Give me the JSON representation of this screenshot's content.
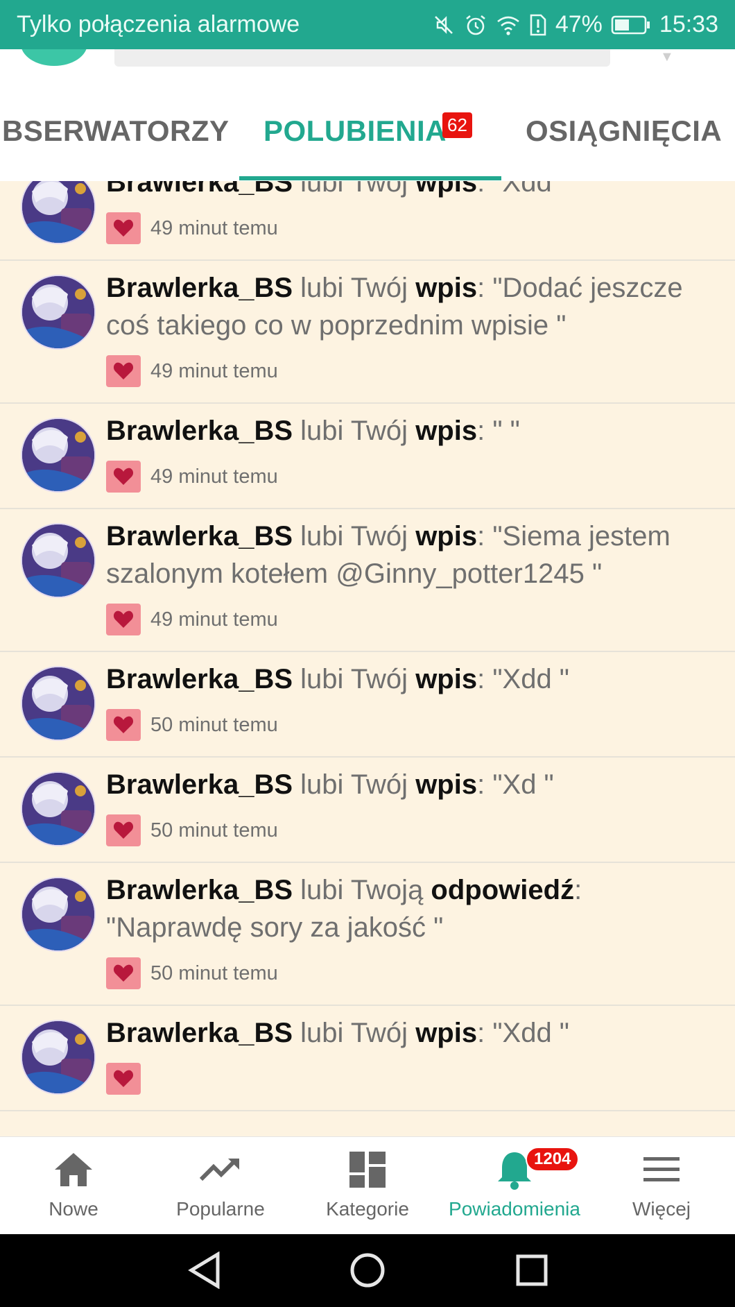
{
  "status_bar": {
    "carrier_text": "Tylko połączenia alarmowe",
    "battery_percent": "47%",
    "time": "15:33",
    "icons": [
      "mute-icon",
      "alarm-icon",
      "wifi-icon",
      "sim-alert-icon",
      "battery-icon"
    ]
  },
  "tabs": {
    "items": [
      {
        "label": "BSERWATORZY",
        "active": false
      },
      {
        "label": "POLUBIENIA",
        "active": true,
        "badge": "62"
      },
      {
        "label": "OSIĄGNIĘCIA",
        "active": false
      }
    ]
  },
  "feed": {
    "items": [
      {
        "user": "Brawlerka_BS",
        "verb": " lubi Twój ",
        "kind": "wpis",
        "text": ": \"Xdd\"",
        "time": "49 minut temu"
      },
      {
        "user": "Brawlerka_BS",
        "verb": " lubi Twój ",
        "kind": "wpis",
        "text": ": \"Dodać jeszcze coś takiego co w poprzednim wpisie \"",
        "time": "49 minut temu"
      },
      {
        "user": "Brawlerka_BS",
        "verb": " lubi Twój ",
        "kind": "wpis",
        "text": ": \" \"",
        "time": "49 minut temu"
      },
      {
        "user": "Brawlerka_BS",
        "verb": " lubi Twój ",
        "kind": "wpis",
        "text": ": \"Siema jestem szalonym kotełem @Ginny_potter1245 \"",
        "time": "49 minut temu"
      },
      {
        "user": "Brawlerka_BS",
        "verb": " lubi Twój ",
        "kind": "wpis",
        "text": ": \"Xdd \"",
        "time": "50 minut temu"
      },
      {
        "user": "Brawlerka_BS",
        "verb": " lubi Twój ",
        "kind": "wpis",
        "text": ": \"Xd \"",
        "time": "50 minut temu"
      },
      {
        "user": "Brawlerka_BS",
        "verb": " lubi Twoją ",
        "kind": "odpowiedź",
        "text": ": \"Naprawdę sory za jakość \"",
        "time": "50 minut temu"
      },
      {
        "user": "Brawlerka_BS",
        "verb": " lubi Twój ",
        "kind": "wpis",
        "text": ": \"Xdd \"",
        "time": ""
      }
    ]
  },
  "bottom_nav": {
    "items": [
      {
        "label": "Nowe",
        "icon": "home-icon"
      },
      {
        "label": "Popularne",
        "icon": "trending-icon"
      },
      {
        "label": "Kategorie",
        "icon": "grid-icon"
      },
      {
        "label": "Powiadomienia",
        "icon": "bell-icon",
        "badge": "1204",
        "active": true
      },
      {
        "label": "Więcej",
        "icon": "menu-icon"
      }
    ]
  },
  "colors": {
    "accent": "#22a88f",
    "feed_background": "#fdf3e1",
    "badge": "#e8140f",
    "heart_bg": "#f28f97",
    "heart": "#b8183c"
  }
}
